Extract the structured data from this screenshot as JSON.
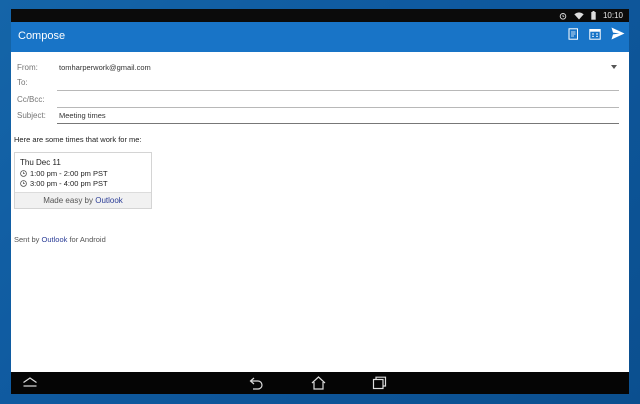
{
  "status_bar": {
    "time": "10:10",
    "icons": [
      "alarm-icon",
      "wifi-icon",
      "battery-icon"
    ]
  },
  "app_bar": {
    "title": "Compose",
    "actions": [
      "insert-file-icon",
      "availability-icon",
      "send-icon"
    ]
  },
  "form": {
    "from_label": "From:",
    "from_value": "tomharperwork@gmail.com",
    "to_label": "To:",
    "to_value": "",
    "cc_label": "Cc/Bcc:",
    "cc_value": "",
    "subject_label": "Subject:",
    "subject_value": "Meeting times"
  },
  "message": {
    "intro": "Here are some times that work for me:",
    "card": {
      "date": "Thu Dec 11",
      "slots": [
        "1:00 pm - 2:00 pm PST",
        "3:00 pm - 4:00 pm PST"
      ],
      "footer_prefix": "Made easy by ",
      "footer_link": "Outlook"
    },
    "signature_prefix": "Sent by ",
    "signature_link": "Outlook",
    "signature_suffix": " for Android"
  },
  "nav_bar": {
    "buttons": [
      "collapse-icon",
      "back-icon",
      "home-icon",
      "recents-icon"
    ]
  },
  "colors": {
    "app_bar": "#1874c7",
    "link": "#2b3d97",
    "background": "#1565a8"
  }
}
